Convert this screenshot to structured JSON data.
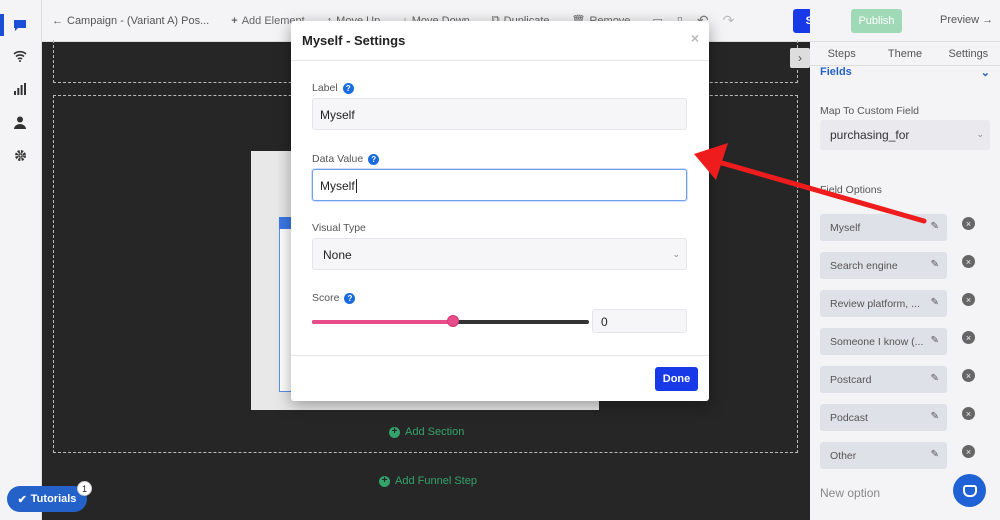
{
  "rail": {
    "icons": [
      "chat-icon",
      "wifi-icon",
      "bar-chart-icon",
      "user-icon",
      "gear-icon"
    ]
  },
  "toolbar": {
    "back_label": "Campaign - (Variant A) Pos...",
    "add_element_label": "Add Element",
    "move_up_label": "Move Up",
    "move_down_label": "Move Down",
    "duplicate_label": "Duplicate",
    "remove_label": "Remove",
    "save_label": "Save",
    "publish_label": "Publish",
    "preview_label": "Preview →"
  },
  "canvas": {
    "add_section_label": "Add Section",
    "add_funnel_step_label": "Add Funnel Step"
  },
  "tutorials": {
    "label": "Tutorials",
    "badge": "1"
  },
  "right_panel": {
    "tabs": [
      "Steps",
      "Theme",
      "Settings"
    ],
    "fields_label": "Fields",
    "map_label": "Map To Custom Field",
    "map_value": "purchasing_for",
    "field_options_label": "Field Options",
    "options": [
      "Myself",
      "Search engine",
      "Review platform, ...",
      "Someone I know (...",
      "Postcard",
      "Podcast",
      "Other"
    ],
    "new_option_placeholder": "New option"
  },
  "modal": {
    "title": "Myself - Settings",
    "close_glyph": "×",
    "label_label": "Label",
    "label_value": "Myself",
    "data_value_label": "Data Value",
    "data_value_value": "Myself",
    "visual_type_label": "Visual Type",
    "visual_type_value": "None",
    "score_label": "Score",
    "score_value": "0",
    "score_slider_percent": 51,
    "done_label": "Done"
  },
  "colors": {
    "primary": "#1739e8",
    "publish": "#9fd9b6",
    "slider": "#e84c8b",
    "add_green": "#33a36b",
    "arrow": "#ee1c1c"
  }
}
